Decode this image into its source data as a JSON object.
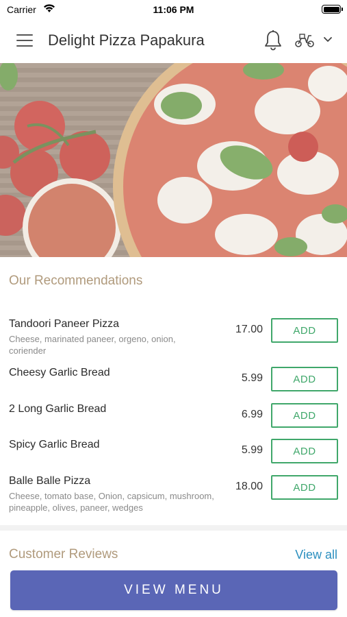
{
  "status_bar": {
    "carrier": "Carrier",
    "time": "11:06 PM"
  },
  "header": {
    "title": "Delight Pizza Papakura",
    "icons": [
      "menu-icon",
      "bell-icon",
      "scooter-icon",
      "chevron-down-icon"
    ]
  },
  "recommendations": {
    "title": "Our Recommendations",
    "add_label": "ADD",
    "items": [
      {
        "name": "Tandoori Paneer Pizza",
        "description": "Cheese, marinated paneer, orgeno, onion, coriender",
        "price": "17.00"
      },
      {
        "name": "Cheesy Garlic Bread",
        "description": "",
        "price": "5.99"
      },
      {
        "name": "2 Long Garlic Bread",
        "description": "",
        "price": "6.99"
      },
      {
        "name": "Spicy Garlic Bread",
        "description": "",
        "price": "5.99"
      },
      {
        "name": "Balle Balle Pizza",
        "description": "Cheese, tomato base, Onion, capsicum, mushroom, pineapple, olives, paneer, wedges",
        "price": "18.00"
      }
    ]
  },
  "reviews": {
    "title": "Customer Reviews",
    "view_all": "View all"
  },
  "footer": {
    "view_menu": "VIEW MENU"
  },
  "colors": {
    "accent_green": "#3fa76a",
    "section_title": "#b09a7c",
    "link_blue": "#2b8fbf",
    "button_blue": "#5a66b6"
  }
}
